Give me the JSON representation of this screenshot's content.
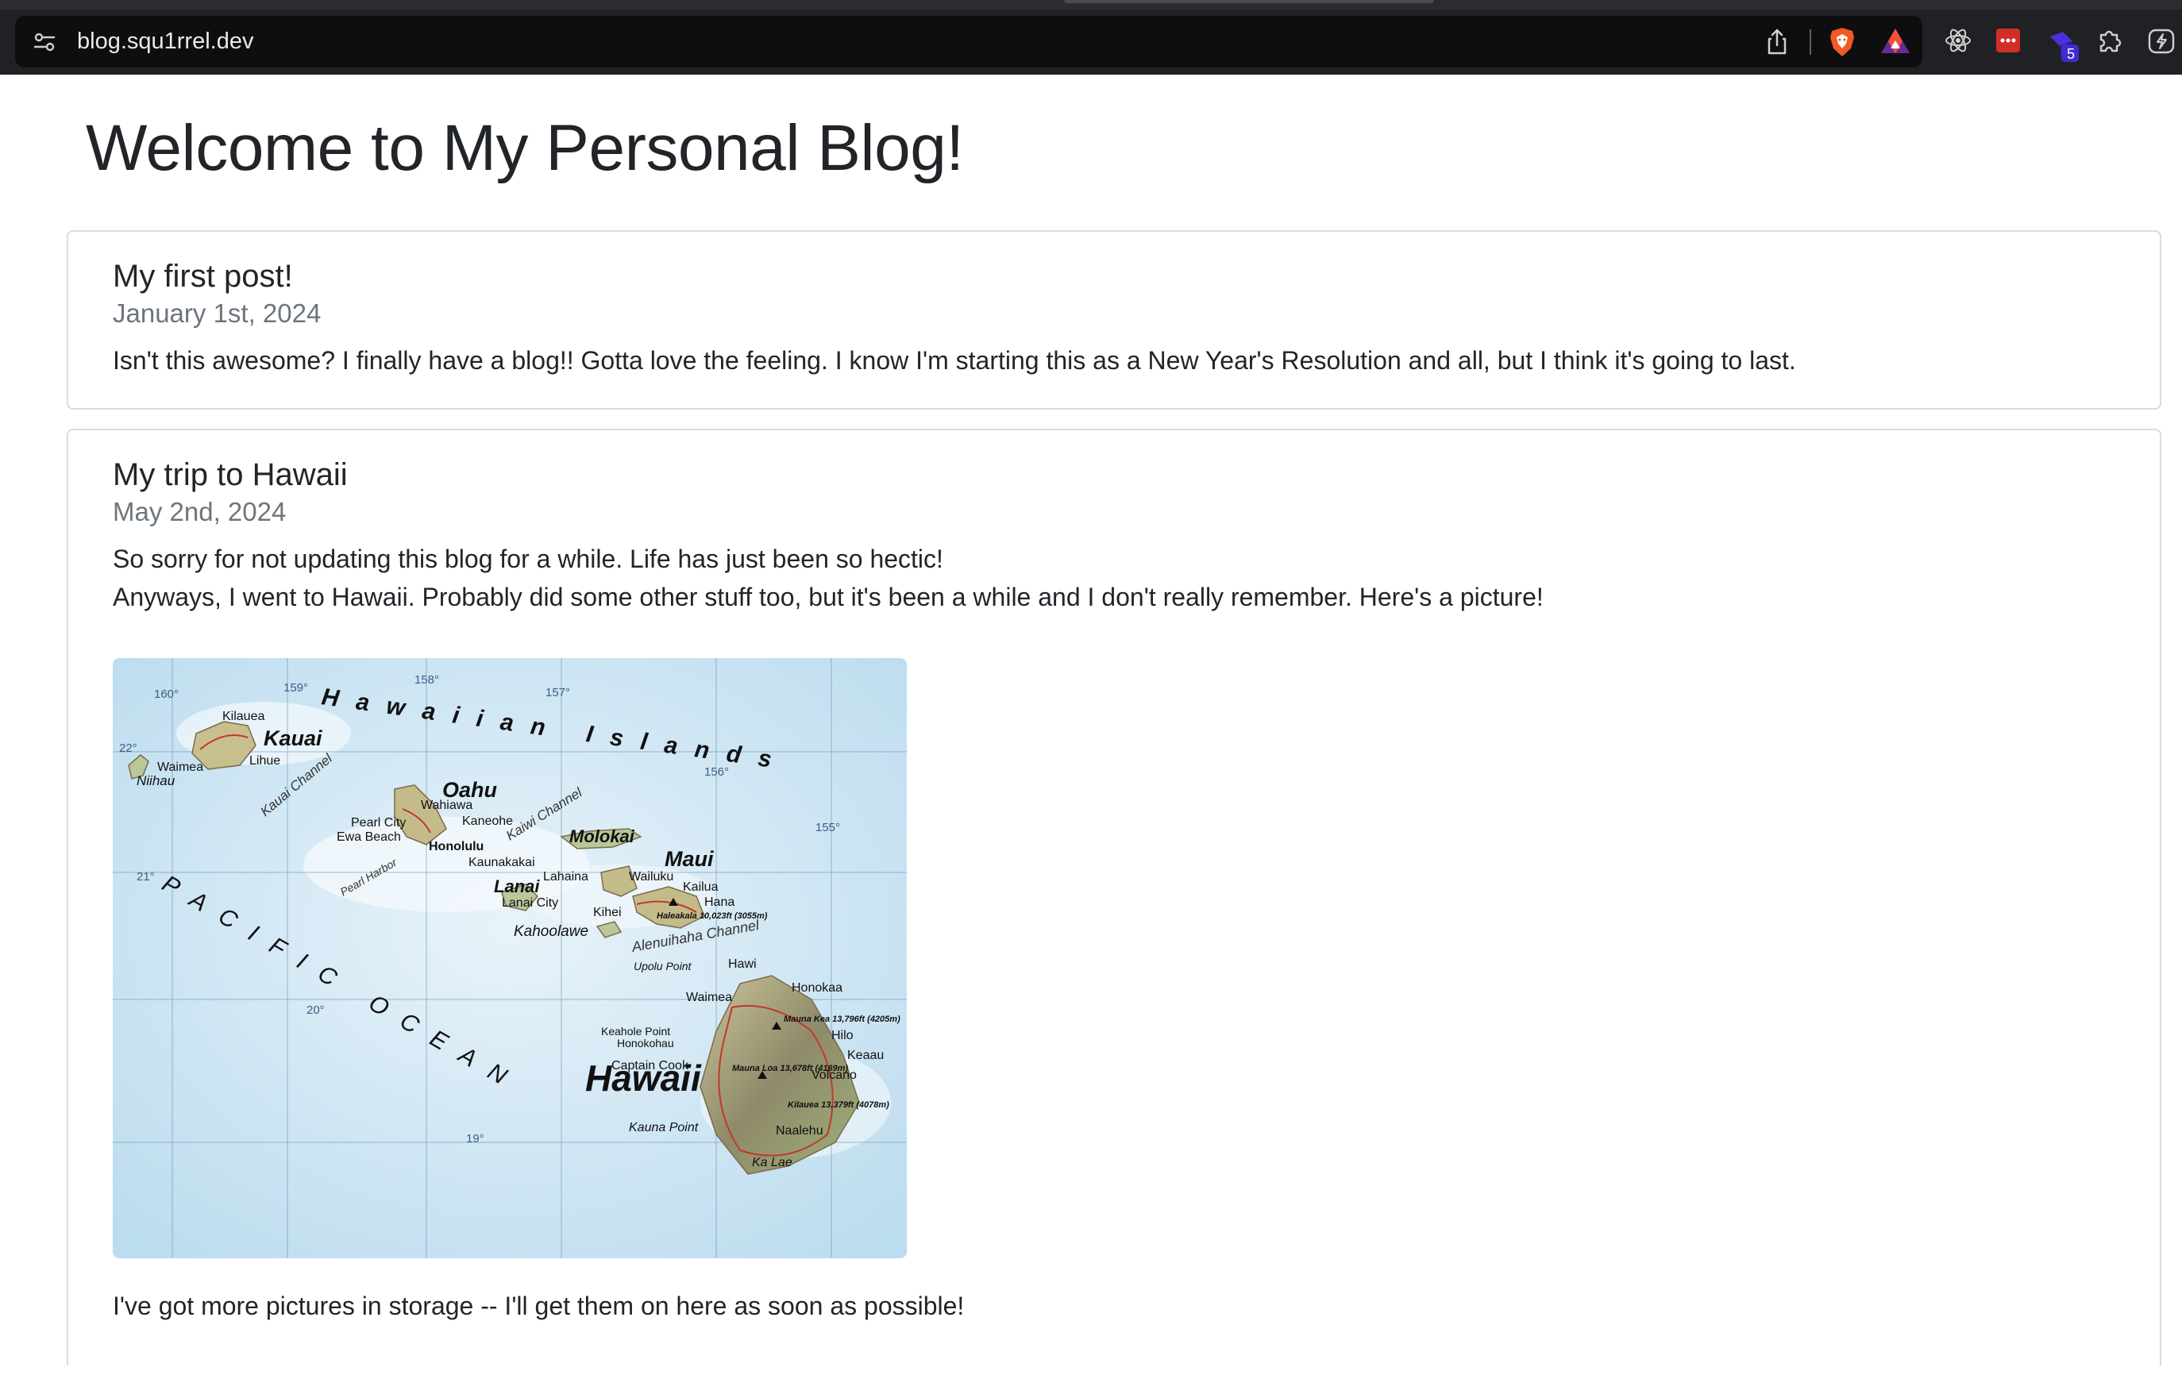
{
  "browser": {
    "url": "blog.squ1rrel.dev",
    "extension_badge_count": "5",
    "icons": [
      "site-settings-icon",
      "share-icon",
      "brave-shields-icon",
      "brave-rewards-icon",
      "react-devtools-icon",
      "password-manager-icon",
      "extension-icon",
      "extensions-puzzle-icon",
      "leo-ai-icon"
    ],
    "colors": {
      "chrome_bg": "#202124",
      "urlbar_bg": "#0e0e10"
    }
  },
  "page": {
    "title": "Welcome to My Personal Blog!"
  },
  "posts": [
    {
      "title": "My first post!",
      "date": "January 1st, 2024",
      "paragraphs": [
        "Isn't this awesome? I finally have a blog!! Gotta love the feeling. I know I'm starting this as a New Year's Resolution and all, but I think it's going to last."
      ]
    },
    {
      "title": "My trip to Hawaii",
      "date": "May 2nd, 2024",
      "paragraphs": [
        "So sorry for not updating this blog for a while. Life has just been so hectic!",
        "Anyways, I went to Hawaii. Probably did some other stuff too, but it's been a while and I don't really remember. Here's a picture!",
        "I've got more pictures in storage -- I'll get them on here as soon as possible!"
      ],
      "image": {
        "header_lettering": "Hawaiian Islands",
        "ocean_lettering": "PACIFIC OCEAN",
        "islands": [
          "Kauai",
          "Oahu",
          "Molokai",
          "Maui",
          "Lanai",
          "Kahoolawe",
          "Hawaii",
          "Niihau"
        ],
        "places": [
          "Kilauea",
          "Lihue",
          "Waimea",
          "Wahiawa",
          "Kaneohe",
          "Pearl City",
          "Ewa Beach",
          "Honolulu",
          "Kaunakakai",
          "Lahaina",
          "Wailuku",
          "Kailua",
          "Hana",
          "Kihei",
          "Lanai City",
          "Hawi",
          "Honokaa",
          "Hilo",
          "Keaau",
          "Volcano",
          "Naalehu",
          "Ka Lae",
          "Kauna Point",
          "Captain Cook",
          "Keahole Point",
          "Honokohau",
          "Upolu Point",
          "Waimea"
        ],
        "channels": [
          "Kauai Channel",
          "Kaiwi Channel",
          "Alenuihaha Channel",
          "Pearl Harbor"
        ],
        "peaks": [
          "Haleakala 10,023ft (3055m)",
          "Mauna Kea 13,796ft (4205m)",
          "Mauna Loa 13,678ft (4169m)",
          "Kilauea 13,379ft (4078m)"
        ],
        "graticule_labels": [
          "160°",
          "159°",
          "158°",
          "157°",
          "156°",
          "155°",
          "22°",
          "21°",
          "20°",
          "19°"
        ],
        "colors": {
          "ocean": "#cfe5f2",
          "land": "#b9c79a",
          "roads": "#c0392b"
        }
      }
    }
  ]
}
